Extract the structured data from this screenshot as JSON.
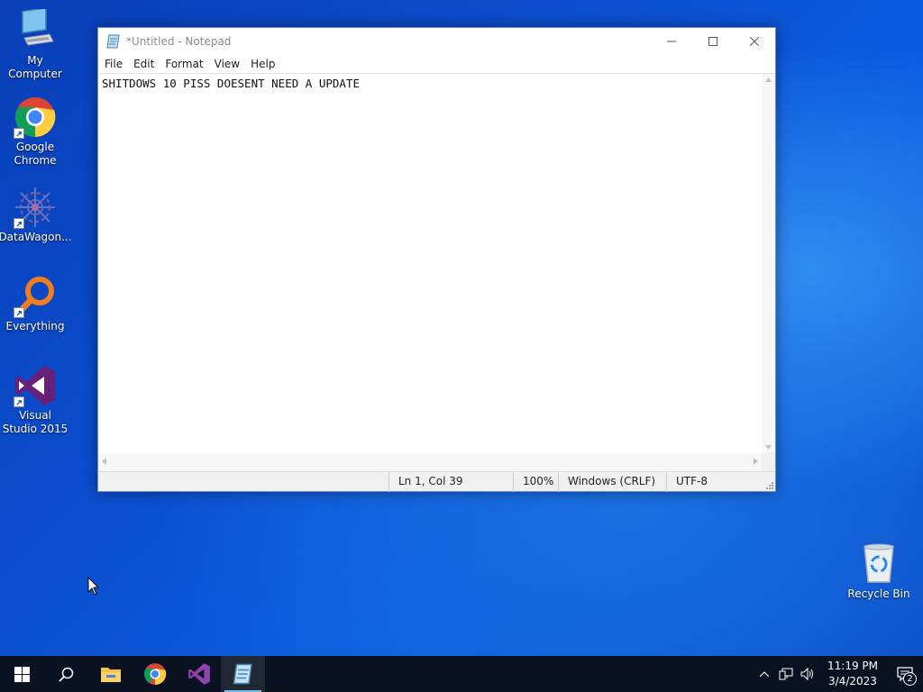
{
  "desktop": {
    "icons": [
      {
        "name": "My Computer",
        "icon": "computer-icon"
      },
      {
        "name": "Google Chrome",
        "icon": "chrome-icon"
      },
      {
        "name": "DataWagon...",
        "icon": "datawagon-icon"
      },
      {
        "name": "Everything",
        "icon": "everything-search-icon"
      },
      {
        "name": "Visual Studio 2015",
        "icon": "visual-studio-icon"
      },
      {
        "name": "Recycle Bin",
        "icon": "recycle-bin-icon"
      }
    ]
  },
  "notepad": {
    "title": "*Untitled - Notepad",
    "menu": [
      "File",
      "Edit",
      "Format",
      "View",
      "Help"
    ],
    "content": "SHITDOWS 10 PISS DOESENT NEED A UPDATE",
    "status": {
      "position": "Ln 1, Col 39",
      "zoom": "100%",
      "line_ending": "Windows (CRLF)",
      "encoding": "UTF-8"
    }
  },
  "taskbar": {
    "apps": [
      "start-icon",
      "search-icon",
      "file-explorer-icon",
      "chrome-icon",
      "visual-studio-icon",
      "notepad-icon"
    ],
    "active_app": "notepad-icon",
    "clock": {
      "time": "11:19 PM",
      "date": "3/4/2023"
    },
    "notifications": "2"
  },
  "colors": {
    "taskbar": "#0b1322",
    "accent": "#76b9ed",
    "desktop": "#0b4fd0"
  }
}
